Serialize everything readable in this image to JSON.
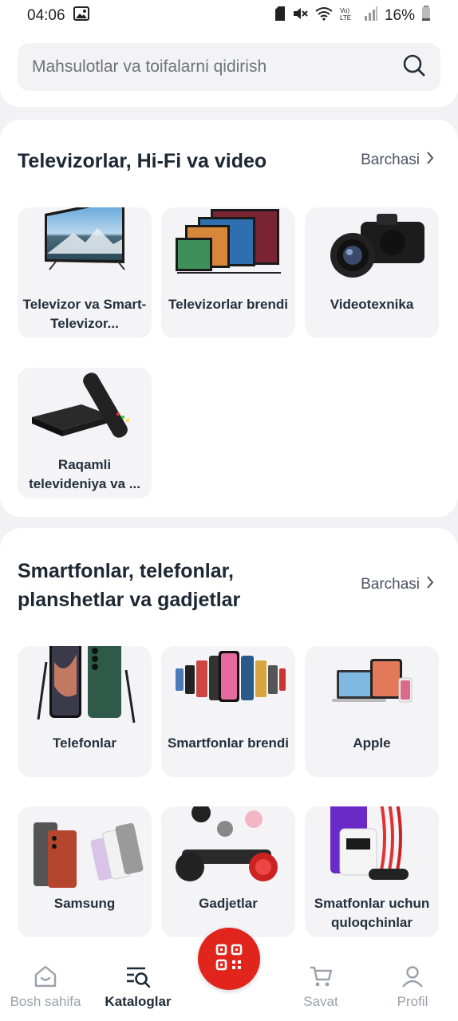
{
  "status_bar": {
    "time": "04:06",
    "battery": "16%"
  },
  "search": {
    "placeholder": "Mahsulotlar va toifalarni qidirish"
  },
  "sections": [
    {
      "title": "Televizorlar, Hi-Fi va video",
      "see_all": "Barchasi",
      "items": [
        {
          "label": "Televizor va Smart-Televizor..."
        },
        {
          "label": "Televizorlar brendi"
        },
        {
          "label": "Videotexnika"
        },
        {
          "label": "Raqamli televideniya va ..."
        }
      ]
    },
    {
      "title_line1": "Smartfonlar, telefonlar,",
      "title_line2": "planshetlar va gadjetlar",
      "see_all": "Barchasi",
      "items": [
        {
          "label": "Telefonlar"
        },
        {
          "label": "Smartfonlar brendi"
        },
        {
          "label": "Apple"
        },
        {
          "label": "Samsung"
        },
        {
          "label": "Gadjetlar"
        },
        {
          "label": "Smatfonlar uchun quloqchinlar"
        }
      ]
    }
  ],
  "bottom_nav": {
    "home": "Bosh sahifa",
    "catalog": "Kataloglar",
    "cart": "Savat",
    "profile": "Profil"
  },
  "colors": {
    "accent": "#e2251c",
    "text_dark": "#1e2a36",
    "nav_inactive": "#9aa1a9"
  }
}
